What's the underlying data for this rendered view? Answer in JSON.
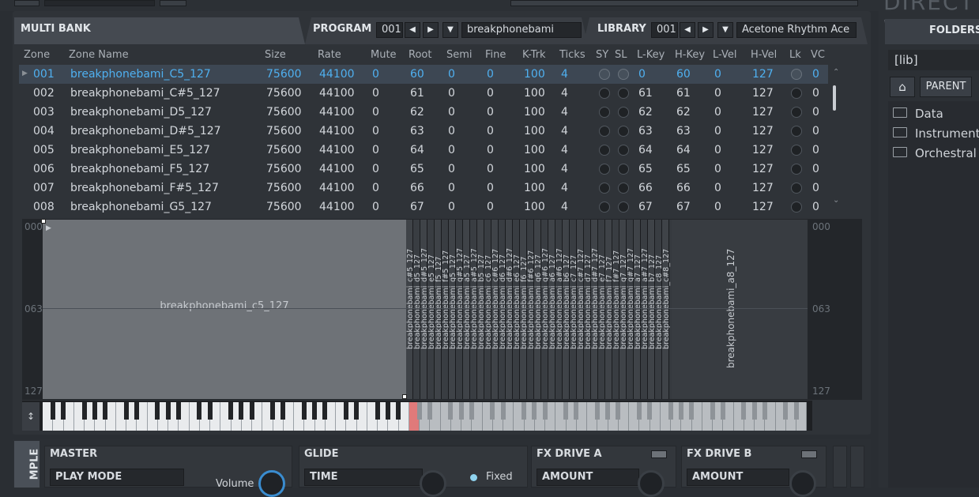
{
  "header": {
    "multibank_label": "MULTI BANK",
    "program_label": "PROGRAM",
    "program_number": "001",
    "program_name": "breakphonebami",
    "library_label": "LIBRARY",
    "library_number": "001",
    "library_name": "Acetone Rhythm Ace"
  },
  "table": {
    "columns": [
      "Zone",
      "Zone Name",
      "Size",
      "Rate",
      "Mute",
      "Root",
      "Semi",
      "Fine",
      "K-Trk",
      "Ticks",
      "SY",
      "SL",
      "L-Key",
      "H-Key",
      "L-Vel",
      "H-Vel",
      "Lk",
      "VC"
    ],
    "rows": [
      [
        "001",
        "breakphonebami_C5_127",
        "75600",
        "44100",
        "0",
        "60",
        "0",
        "0",
        "100",
        "4",
        "0",
        "60",
        "0",
        "127",
        "0"
      ],
      [
        "002",
        "breakphonebami_C#5_127",
        "75600",
        "44100",
        "0",
        "61",
        "0",
        "0",
        "100",
        "4",
        "61",
        "61",
        "0",
        "127",
        "0"
      ],
      [
        "003",
        "breakphonebami_D5_127",
        "75600",
        "44100",
        "0",
        "62",
        "0",
        "0",
        "100",
        "4",
        "62",
        "62",
        "0",
        "127",
        "0"
      ],
      [
        "004",
        "breakphonebami_D#5_127",
        "75600",
        "44100",
        "0",
        "63",
        "0",
        "0",
        "100",
        "4",
        "63",
        "63",
        "0",
        "127",
        "0"
      ],
      [
        "005",
        "breakphonebami_E5_127",
        "75600",
        "44100",
        "0",
        "64",
        "0",
        "0",
        "100",
        "4",
        "64",
        "64",
        "0",
        "127",
        "0"
      ],
      [
        "006",
        "breakphonebami_F5_127",
        "75600",
        "44100",
        "0",
        "65",
        "0",
        "0",
        "100",
        "4",
        "65",
        "65",
        "0",
        "127",
        "0"
      ],
      [
        "007",
        "breakphonebami_F#5_127",
        "75600",
        "44100",
        "0",
        "66",
        "0",
        "0",
        "100",
        "4",
        "66",
        "66",
        "0",
        "127",
        "0"
      ],
      [
        "008",
        "breakphonebami_G5_127",
        "75600",
        "44100",
        "0",
        "67",
        "0",
        "0",
        "100",
        "4",
        "67",
        "67",
        "0",
        "127",
        "0"
      ]
    ]
  },
  "zonemap": {
    "ticks": [
      "000",
      "063",
      "127"
    ],
    "first_zone": "breakphonebami_c5_127",
    "last_zone": "breakphonebami_a8_127",
    "strip_labels": [
      "breakphonebami_c#5_127",
      "breakphonebami_d5_127",
      "breakphonebami_d#5_127",
      "breakphonebami_e5_127",
      "breakphonebami_f5_127",
      "breakphonebami_f#5_127",
      "breakphonebami_g5_127",
      "breakphonebami_g#5_127",
      "breakphonebami_a5_127",
      "breakphonebami_a#5_127",
      "breakphonebami_b5_127",
      "breakphonebami_c6_127",
      "breakphonebami_c#6_127",
      "breakphonebami_d6_127",
      "breakphonebami_d#6_127",
      "breakphonebami_e6_127",
      "breakphonebami_f6_127",
      "breakphonebami_f#6_127",
      "breakphonebami_g6_127",
      "breakphonebami_g#6_127",
      "breakphonebami_a6_127",
      "breakphonebami_a#6_127",
      "breakphonebami_b6_127",
      "breakphonebami_c7_127",
      "breakphonebami_c#7_127",
      "breakphonebami_d7_127",
      "breakphonebami_d#7_127",
      "breakphonebami_e7_127",
      "breakphonebami_f7_127",
      "breakphonebami_f#7_127",
      "breakphonebami_g7_127",
      "breakphonebami_g#7_127",
      "breakphonebami_a7_127",
      "breakphonebami_a#7_127",
      "breakphonebami_b7_127",
      "breakphonebami_c8_127",
      "breakphonebami_c#8_127"
    ]
  },
  "bottom": {
    "sidetab": "MPLE",
    "master": {
      "title": "MASTER",
      "play_mode": "PLAY MODE",
      "volume": "Volume"
    },
    "glide": {
      "title": "GLIDE",
      "time": "TIME",
      "fixed": "Fixed"
    },
    "fxa": {
      "title": "FX DRIVE A",
      "amount": "AMOUNT"
    },
    "fxb": {
      "title": "FX DRIVE B",
      "amount": "AMOUNT"
    }
  },
  "right": {
    "title": "DIRECT W",
    "folders_label": "FOLDERS",
    "path": "[lib]",
    "parent_label": "PARENT",
    "folders": [
      "Data",
      "Instrument",
      "Orchestral"
    ]
  },
  "colors": {
    "accent": "#4fb0f0",
    "selected_row": "#3d4753",
    "key_marker": "#e07a7a"
  }
}
